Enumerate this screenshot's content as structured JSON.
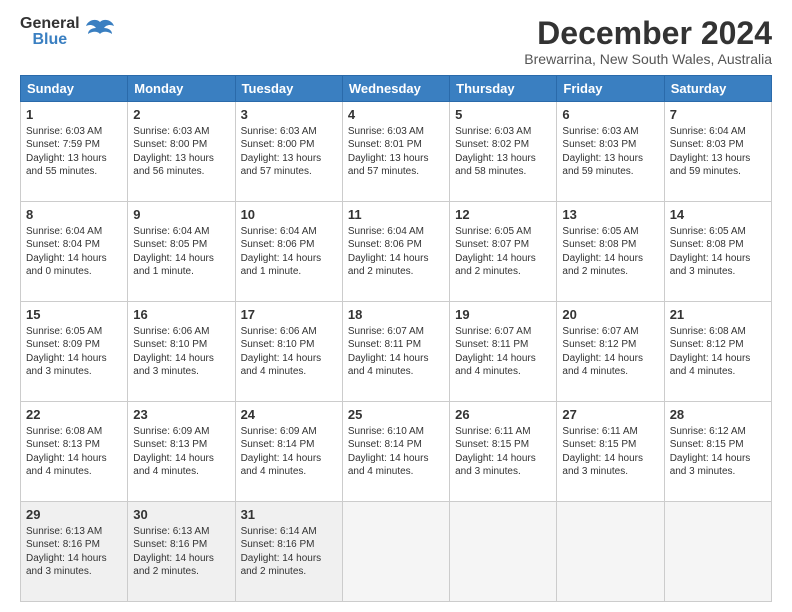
{
  "logo": {
    "line1": "General",
    "line2": "Blue"
  },
  "title": "December 2024",
  "subtitle": "Brewarrina, New South Wales, Australia",
  "days": [
    "Sunday",
    "Monday",
    "Tuesday",
    "Wednesday",
    "Thursday",
    "Friday",
    "Saturday"
  ],
  "weeks": [
    [
      {
        "day": "1",
        "sunrise": "6:03 AM",
        "sunset": "7:59 PM",
        "daylight": "13 hours and 55 minutes."
      },
      {
        "day": "2",
        "sunrise": "6:03 AM",
        "sunset": "8:00 PM",
        "daylight": "13 hours and 56 minutes."
      },
      {
        "day": "3",
        "sunrise": "6:03 AM",
        "sunset": "8:00 PM",
        "daylight": "13 hours and 57 minutes."
      },
      {
        "day": "4",
        "sunrise": "6:03 AM",
        "sunset": "8:01 PM",
        "daylight": "13 hours and 57 minutes."
      },
      {
        "day": "5",
        "sunrise": "6:03 AM",
        "sunset": "8:02 PM",
        "daylight": "13 hours and 58 minutes."
      },
      {
        "day": "6",
        "sunrise": "6:03 AM",
        "sunset": "8:03 PM",
        "daylight": "13 hours and 59 minutes."
      },
      {
        "day": "7",
        "sunrise": "6:04 AM",
        "sunset": "8:03 PM",
        "daylight": "13 hours and 59 minutes."
      }
    ],
    [
      {
        "day": "8",
        "sunrise": "6:04 AM",
        "sunset": "8:04 PM",
        "daylight": "14 hours and 0 minutes."
      },
      {
        "day": "9",
        "sunrise": "6:04 AM",
        "sunset": "8:05 PM",
        "daylight": "14 hours and 1 minute."
      },
      {
        "day": "10",
        "sunrise": "6:04 AM",
        "sunset": "8:06 PM",
        "daylight": "14 hours and 1 minute."
      },
      {
        "day": "11",
        "sunrise": "6:04 AM",
        "sunset": "8:06 PM",
        "daylight": "14 hours and 2 minutes."
      },
      {
        "day": "12",
        "sunrise": "6:05 AM",
        "sunset": "8:07 PM",
        "daylight": "14 hours and 2 minutes."
      },
      {
        "day": "13",
        "sunrise": "6:05 AM",
        "sunset": "8:08 PM",
        "daylight": "14 hours and 2 minutes."
      },
      {
        "day": "14",
        "sunrise": "6:05 AM",
        "sunset": "8:08 PM",
        "daylight": "14 hours and 3 minutes."
      }
    ],
    [
      {
        "day": "15",
        "sunrise": "6:05 AM",
        "sunset": "8:09 PM",
        "daylight": "14 hours and 3 minutes."
      },
      {
        "day": "16",
        "sunrise": "6:06 AM",
        "sunset": "8:10 PM",
        "daylight": "14 hours and 3 minutes."
      },
      {
        "day": "17",
        "sunrise": "6:06 AM",
        "sunset": "8:10 PM",
        "daylight": "14 hours and 4 minutes."
      },
      {
        "day": "18",
        "sunrise": "6:07 AM",
        "sunset": "8:11 PM",
        "daylight": "14 hours and 4 minutes."
      },
      {
        "day": "19",
        "sunrise": "6:07 AM",
        "sunset": "8:11 PM",
        "daylight": "14 hours and 4 minutes."
      },
      {
        "day": "20",
        "sunrise": "6:07 AM",
        "sunset": "8:12 PM",
        "daylight": "14 hours and 4 minutes."
      },
      {
        "day": "21",
        "sunrise": "6:08 AM",
        "sunset": "8:12 PM",
        "daylight": "14 hours and 4 minutes."
      }
    ],
    [
      {
        "day": "22",
        "sunrise": "6:08 AM",
        "sunset": "8:13 PM",
        "daylight": "14 hours and 4 minutes."
      },
      {
        "day": "23",
        "sunrise": "6:09 AM",
        "sunset": "8:13 PM",
        "daylight": "14 hours and 4 minutes."
      },
      {
        "day": "24",
        "sunrise": "6:09 AM",
        "sunset": "8:14 PM",
        "daylight": "14 hours and 4 minutes."
      },
      {
        "day": "25",
        "sunrise": "6:10 AM",
        "sunset": "8:14 PM",
        "daylight": "14 hours and 4 minutes."
      },
      {
        "day": "26",
        "sunrise": "6:11 AM",
        "sunset": "8:15 PM",
        "daylight": "14 hours and 3 minutes."
      },
      {
        "day": "27",
        "sunrise": "6:11 AM",
        "sunset": "8:15 PM",
        "daylight": "14 hours and 3 minutes."
      },
      {
        "day": "28",
        "sunrise": "6:12 AM",
        "sunset": "8:15 PM",
        "daylight": "14 hours and 3 minutes."
      }
    ],
    [
      {
        "day": "29",
        "sunrise": "6:13 AM",
        "sunset": "8:16 PM",
        "daylight": "14 hours and 3 minutes."
      },
      {
        "day": "30",
        "sunrise": "6:13 AM",
        "sunset": "8:16 PM",
        "daylight": "14 hours and 2 minutes."
      },
      {
        "day": "31",
        "sunrise": "6:14 AM",
        "sunset": "8:16 PM",
        "daylight": "14 hours and 2 minutes."
      },
      null,
      null,
      null,
      null
    ]
  ]
}
